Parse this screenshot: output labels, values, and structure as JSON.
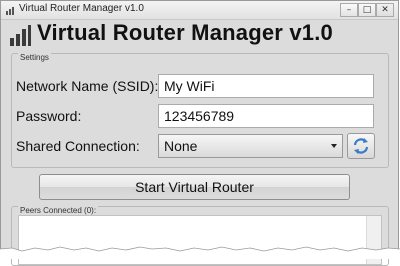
{
  "window": {
    "title": "Virtual Router Manager v1.0"
  },
  "header": {
    "title": "Virtual Router Manager v1.0"
  },
  "settings": {
    "legend": "Settings",
    "ssid_label": "Network Name (SSID):",
    "ssid_value": "My WiFi",
    "password_label": "Password:",
    "password_value": "123456789",
    "shared_label": "Shared Connection:",
    "shared_value": "None"
  },
  "actions": {
    "start_label": "Start Virtual Router"
  },
  "peers": {
    "legend": "Peers Connected (0):"
  },
  "icons": {
    "app": "router-icon",
    "refresh": "refresh-icon",
    "minimize": "minimize-icon",
    "maximize": "maximize-icon",
    "close": "close-icon",
    "dropdown": "chevron-down-icon"
  },
  "colors": {
    "refresh_accent": "#3a7cc7",
    "window_bg": "#dcdcdc"
  }
}
